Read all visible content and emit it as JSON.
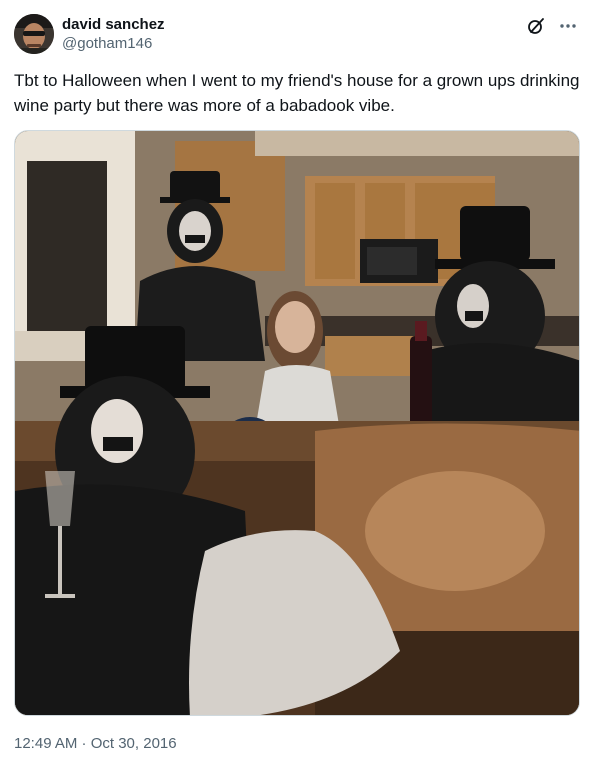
{
  "author": {
    "display_name": "david sanchez",
    "handle": "@gotham146"
  },
  "header_icons": {
    "grok": "grok-icon",
    "more": "more-options-icon"
  },
  "tweet": {
    "text": "Tbt to Halloween when I went to my friend's house for a grown ups drinking wine party but there was more of a babadook vibe.",
    "timestamp": "12:49 AM · Oct 30, 2016"
  },
  "colors": {
    "text_primary": "#0f1419",
    "text_secondary": "#536471",
    "border": "#cfd9de"
  }
}
